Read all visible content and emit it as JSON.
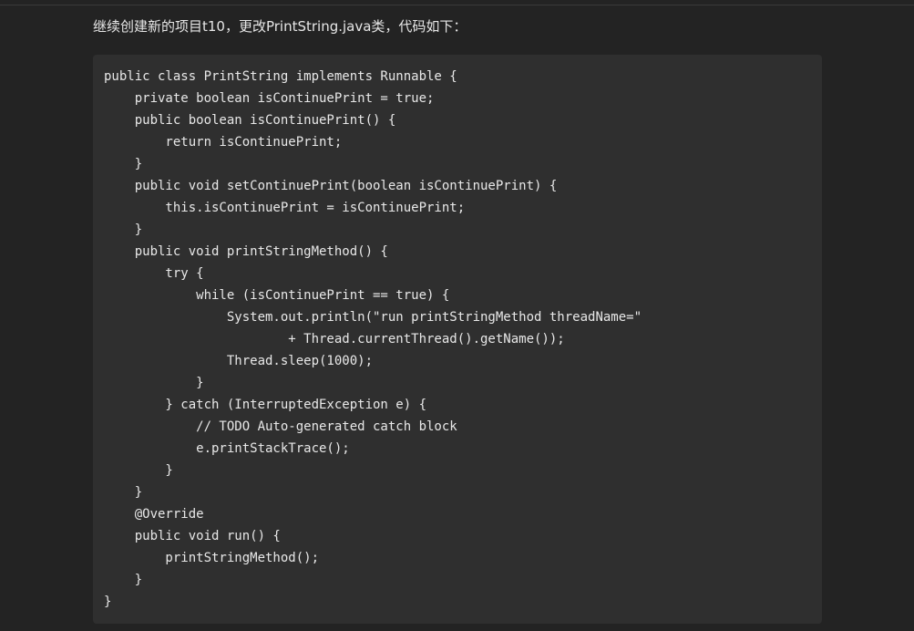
{
  "article": {
    "intro_text": "继续创建新的项目t10，更改PrintString.java类，代码如下："
  },
  "code_block": {
    "language": "java",
    "lines": [
      "public class PrintString implements Runnable {",
      "    private boolean isContinuePrint = true;",
      "    public boolean isContinuePrint() {",
      "        return isContinuePrint;",
      "    }",
      "    public void setContinuePrint(boolean isContinuePrint) {",
      "        this.isContinuePrint = isContinuePrint;",
      "    }",
      "    public void printStringMethod() {",
      "        try {",
      "            while (isContinuePrint == true) {",
      "                System.out.println(\"run printStringMethod threadName=\"",
      "                        + Thread.currentThread().getName());",
      "                Thread.sleep(1000);",
      "            }",
      "        } catch (InterruptedException e) {",
      "            // TODO Auto-generated catch block",
      "            e.printStackTrace();",
      "        }",
      "    }",
      "    @Override",
      "    public void run() {",
      "        printStringMethod();",
      "    }",
      "}"
    ]
  },
  "colors": {
    "page_background": "#232323",
    "code_background": "#2f2f2f",
    "text": "#e8e8e8",
    "divider": "#3a3a3a"
  }
}
